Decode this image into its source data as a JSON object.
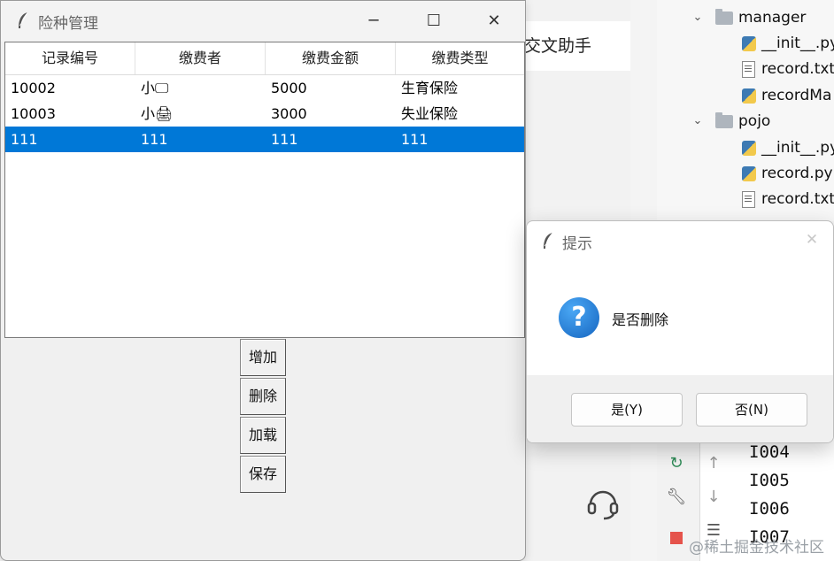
{
  "background": {
    "assistant_text": "交文助手",
    "tree": [
      {
        "label": "manager",
        "kind": "folder"
      },
      {
        "label": "__init__.py",
        "kind": "py"
      },
      {
        "label": "record.txt",
        "kind": "txt"
      },
      {
        "label": "recordMa",
        "kind": "py"
      },
      {
        "label": "pojo",
        "kind": "folder"
      },
      {
        "label": "__init__.py",
        "kind": "py"
      },
      {
        "label": "record.py",
        "kind": "py"
      },
      {
        "label": "record.txt",
        "kind": "txt"
      }
    ],
    "console": [
      "I004",
      "I005",
      "I006",
      "I007"
    ],
    "watermark": "@稀土掘金技术社区"
  },
  "window": {
    "title": "险种管理",
    "columns": [
      "记录编号",
      "缴费者",
      "缴费金额",
      "缴费类型"
    ],
    "rows": [
      [
        "10002",
        "小🖵",
        "5000",
        "生育保险"
      ],
      [
        "10003",
        "小🖨",
        "3000",
        "失业保险"
      ],
      [
        "111",
        "111",
        "111",
        "111"
      ]
    ],
    "selected_row": 2,
    "buttons": {
      "add": "增加",
      "delete": "删除",
      "load": "加载",
      "save": "保存"
    }
  },
  "dialog": {
    "title": "提示",
    "message": "是否删除",
    "yes": "是(Y)",
    "no": "否(N)"
  },
  "colors": {
    "selection": "#0078d7",
    "dialog_icon": "#1e88e5"
  }
}
